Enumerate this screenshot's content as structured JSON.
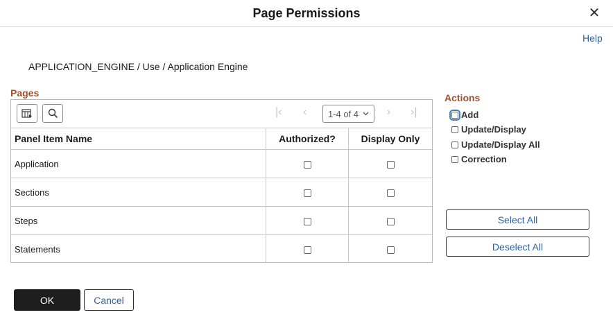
{
  "dialog": {
    "title": "Page Permissions",
    "close_glyph": "✕"
  },
  "help_link": "Help",
  "breadcrumb": "APPLICATION_ENGINE / Use / Application Engine",
  "pages": {
    "title": "Pages",
    "pager": "1-4 of 4",
    "columns": [
      "Panel Item Name",
      "Authorized?",
      "Display Only"
    ],
    "rows": [
      {
        "name": "Application",
        "authorized": false,
        "display_only": false
      },
      {
        "name": "Sections",
        "authorized": false,
        "display_only": false
      },
      {
        "name": "Steps",
        "authorized": false,
        "display_only": false
      },
      {
        "name": "Statements",
        "authorized": false,
        "display_only": false
      }
    ]
  },
  "actions": {
    "title": "Actions",
    "items": [
      {
        "label": "Add",
        "checked": false
      },
      {
        "label": "Update/Display",
        "checked": false
      },
      {
        "label": "Update/Display All",
        "checked": false
      },
      {
        "label": "Correction",
        "checked": false
      }
    ],
    "select_all": "Select All",
    "deselect_all": "Deselect All"
  },
  "footer": {
    "ok": "OK",
    "cancel": "Cancel"
  }
}
